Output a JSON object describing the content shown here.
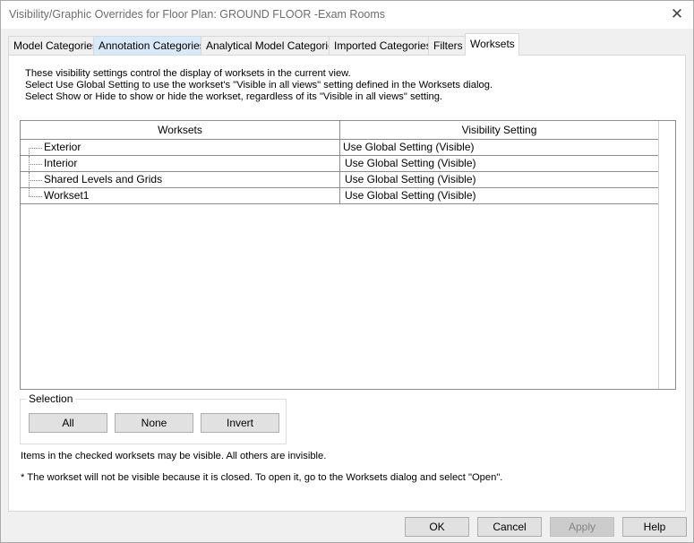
{
  "window": {
    "title": "Visibility/Graphic Overrides for Floor Plan: GROUND FLOOR -Exam Rooms",
    "close_glyph": "✕"
  },
  "tabs": [
    {
      "label": "Model Categories"
    },
    {
      "label": "Annotation Categories"
    },
    {
      "label": "Analytical Model Categories"
    },
    {
      "label": "Imported Categories"
    },
    {
      "label": "Filters"
    },
    {
      "label": "Worksets"
    }
  ],
  "active_tab": "Worksets",
  "intro": {
    "line1": "These visibility settings control the display of worksets in the current view.",
    "line2": "Select Use Global Setting to use the workset's \"Visible in all views\" setting defined in the Worksets dialog.",
    "line3": "Select Show or Hide to show or hide the workset, regardless of its \"Visible in all views\" setting."
  },
  "grid": {
    "headers": [
      "Worksets",
      "Visibility Setting"
    ],
    "rows": [
      {
        "name": "Exterior",
        "visibility": "Use Global Setting (Visible)"
      },
      {
        "name": "Interior",
        "visibility": "Use Global Setting (Visible)"
      },
      {
        "name": "Shared Levels and Grids",
        "visibility": "Use Global Setting (Visible)"
      },
      {
        "name": "Workset1",
        "visibility": "Use Global Setting (Visible)"
      }
    ]
  },
  "selection": {
    "legend": "Selection",
    "all": "All",
    "none": "None",
    "invert": "Invert"
  },
  "notes": {
    "line1": "Items in the checked worksets may be visible.  All others are invisible.",
    "line2": "* The workset will not be visible because it is closed. To open it, go to the Worksets dialog and select \"Open\"."
  },
  "footer": {
    "ok": "OK",
    "cancel": "Cancel",
    "apply": "Apply",
    "help": "Help"
  }
}
